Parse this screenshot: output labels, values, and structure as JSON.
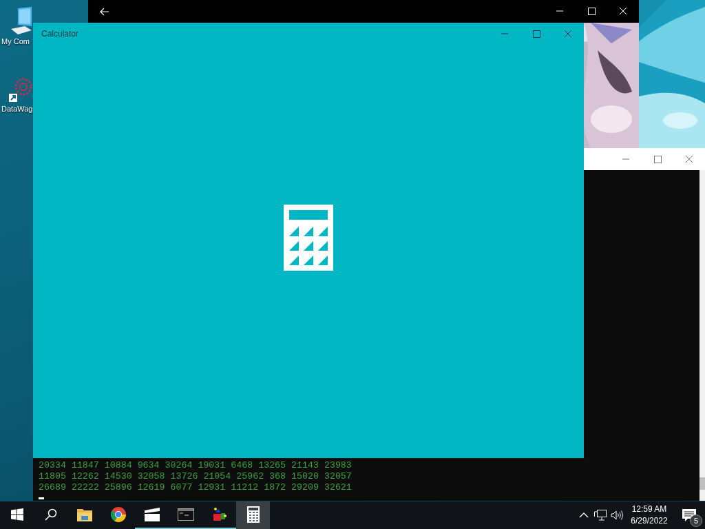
{
  "desktop_icons": [
    {
      "kind": "computer",
      "label": "My Com"
    },
    {
      "kind": "shortcut",
      "label": "DataWag"
    }
  ],
  "console_window": {
    "lines": [
      "20334 11847 10884 9634 30264 19031 6468 13265 21143 23983",
      "11805 12262 14530 32058 13726 21054 25962 368 15020 32057",
      "26689 22222 25896 12619 6077 12931 11212 1872 29209 32621"
    ]
  },
  "calculator_window": {
    "title": "Calculator"
  },
  "taskbar": {
    "apps": [
      {
        "kind": "start",
        "running": false,
        "selected": false
      },
      {
        "kind": "search",
        "running": false,
        "selected": false
      },
      {
        "kind": "folder",
        "running": false,
        "selected": false
      },
      {
        "kind": "browser",
        "running": false,
        "selected": false
      },
      {
        "kind": "video",
        "running": true,
        "selected": false
      },
      {
        "kind": "console",
        "running": true,
        "selected": false
      },
      {
        "kind": "paint",
        "running": true,
        "selected": false
      },
      {
        "kind": "calculator",
        "running": false,
        "selected": true
      }
    ],
    "clock": {
      "time": "12:59 AM",
      "date": "6/29/2022"
    },
    "notifications": {
      "count": "5"
    }
  }
}
